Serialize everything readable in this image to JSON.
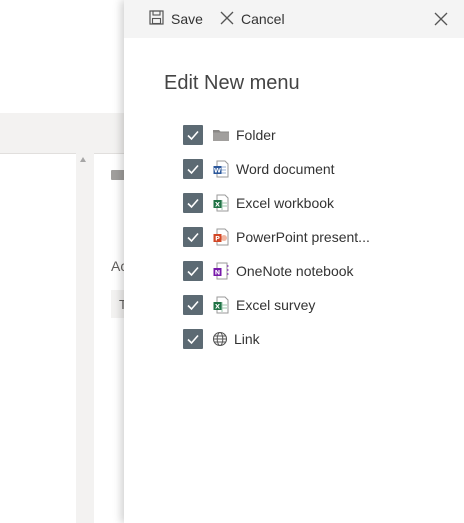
{
  "toolbar": {
    "save_label": "Save",
    "cancel_label": "Cancel"
  },
  "panel": {
    "title": "Edit New menu"
  },
  "items": [
    {
      "label": "Folder",
      "checked": true,
      "icon": "folder-icon"
    },
    {
      "label": "Word document",
      "checked": true,
      "icon": "word-icon"
    },
    {
      "label": "Excel workbook",
      "checked": true,
      "icon": "excel-icon"
    },
    {
      "label": "PowerPoint present...",
      "checked": true,
      "icon": "powerpoint-icon"
    },
    {
      "label": "OneNote notebook",
      "checked": true,
      "icon": "onenote-icon"
    },
    {
      "label": "Excel survey",
      "checked": true,
      "icon": "excel-icon"
    },
    {
      "label": "Link",
      "checked": true,
      "icon": "globe-icon"
    }
  ],
  "background": {
    "text_a": "Ac",
    "text_t": "T"
  },
  "colors": {
    "checkbox": "#5c6a73",
    "word": "#2b579a",
    "excel": "#217346",
    "powerpoint": "#d24726",
    "onenote": "#7719aa"
  }
}
